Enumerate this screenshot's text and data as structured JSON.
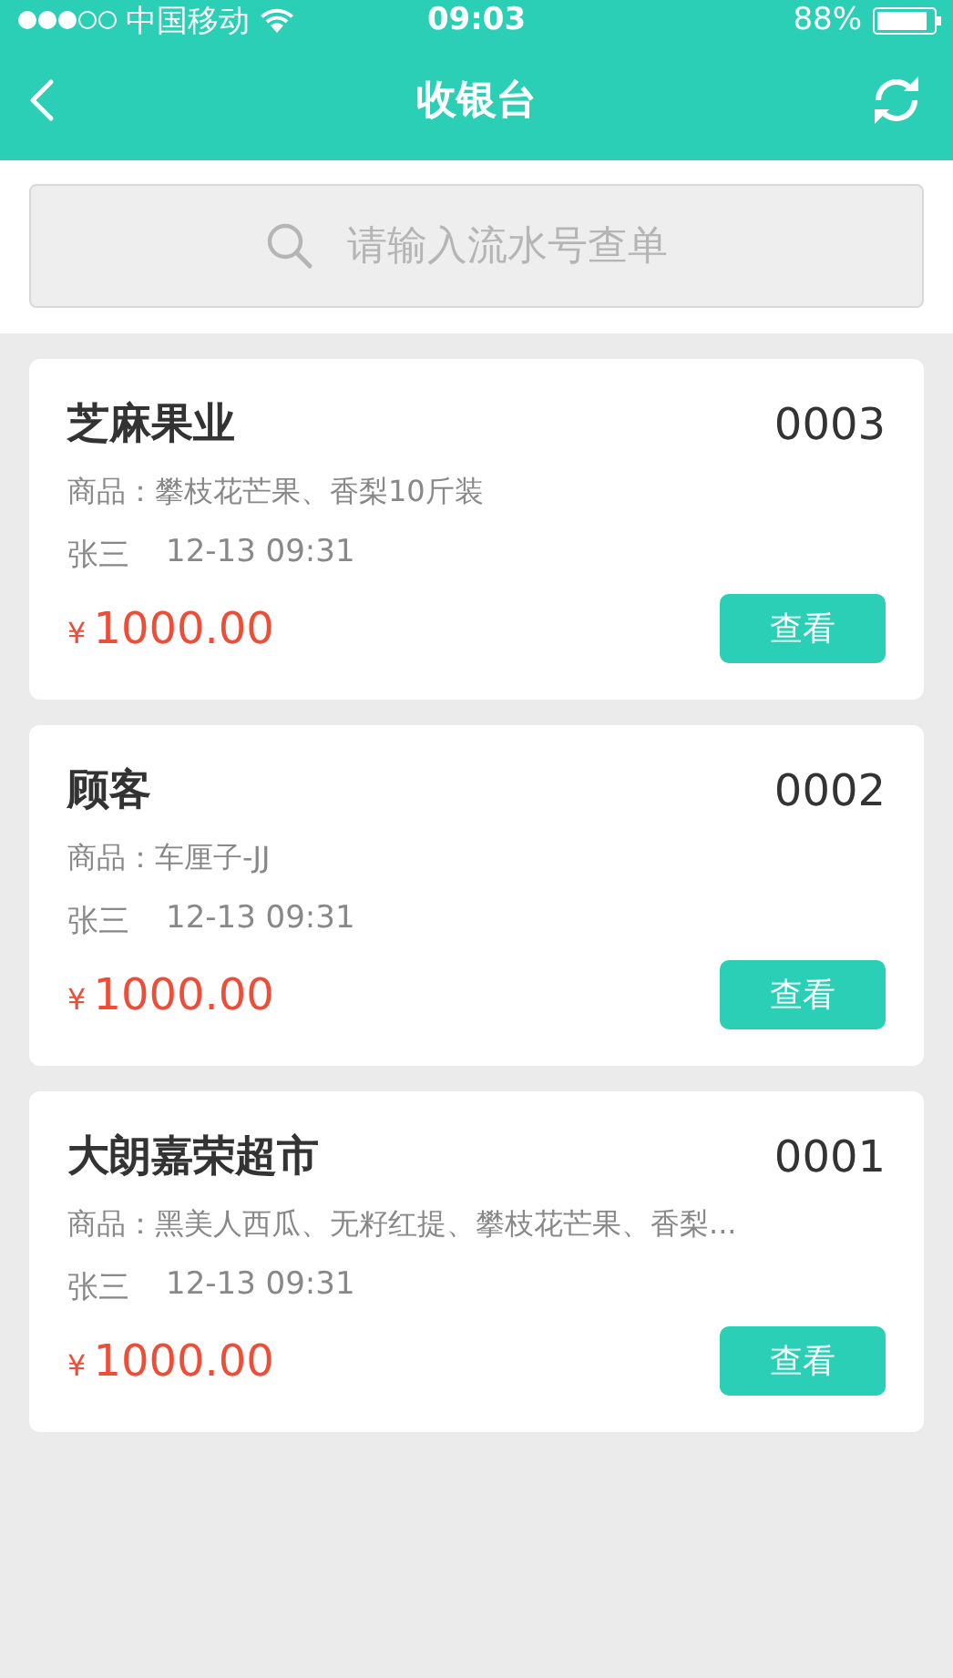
{
  "status_bar": {
    "carrier": "中国移动",
    "time": "09:03",
    "battery": "88%"
  },
  "nav_bar": {
    "title": "收银台"
  },
  "search": {
    "placeholder": "请输入流水号查单"
  },
  "orders": [
    {
      "customer": "芝麻果业",
      "number": "0003",
      "goods": "商品：攀枝花芒果、香梨10斤装",
      "operator": "张三",
      "time": "12-13 09:31",
      "currency": "¥",
      "amount": "1000.00",
      "action": "查看"
    },
    {
      "customer": "顾客",
      "number": "0002",
      "goods": "商品：车厘子-JJ",
      "operator": "张三",
      "time": "12-13 09:31",
      "currency": "¥",
      "amount": "1000.00",
      "action": "查看"
    },
    {
      "customer": "大朗嘉荣超市",
      "number": "0001",
      "goods": "商品：黑美人西瓜、无籽红提、攀枝花芒果、香梨...",
      "operator": "张三",
      "time": "12-13 09:31",
      "currency": "¥",
      "amount": "1000.00",
      "action": "查看"
    }
  ]
}
